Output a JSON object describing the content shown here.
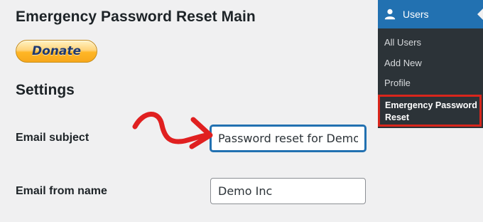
{
  "page": {
    "title": "Emergency Password Reset Main",
    "donate_label": "Donate",
    "settings_heading": "Settings"
  },
  "form": {
    "email_subject": {
      "label": "Email subject",
      "value": "Password reset for Demo"
    },
    "email_from_name": {
      "label": "Email from name",
      "value": "Demo Inc"
    }
  },
  "sidebar": {
    "menu_title": "Users",
    "menu_icon": "user-icon",
    "items": [
      {
        "label": "All Users"
      },
      {
        "label": "Add New"
      },
      {
        "label": "Profile"
      },
      {
        "label": "Emergency Password Reset",
        "highlighted": true
      }
    ],
    "colors": {
      "background": "#2c3338",
      "active": "#2271b1",
      "highlight_border": "#d9261c"
    }
  },
  "annotation": {
    "arrow_color": "#e02020"
  }
}
